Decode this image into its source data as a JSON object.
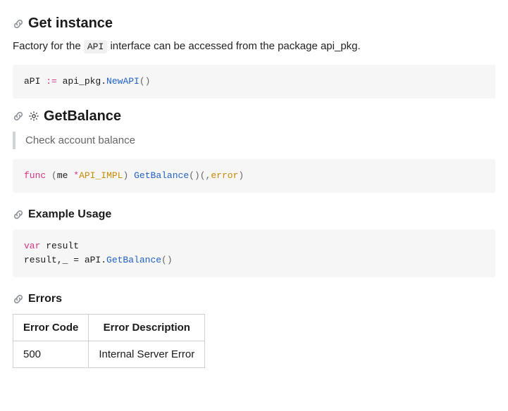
{
  "sections": {
    "get_instance": {
      "title": "Get instance",
      "para_parts": {
        "pre": "Factory for the ",
        "code": "API",
        "post": " interface can be accessed from the package api_pkg."
      },
      "code": {
        "t1": "aPI ",
        "t2": ":=",
        "t3": " api_pkg.",
        "t4": "NewAPI",
        "t5": "()"
      }
    },
    "get_balance": {
      "title": "GetBalance",
      "desc": "Check account balance",
      "code": {
        "t1": "func",
        "t2": " ",
        "t3": "(",
        "t4": "me ",
        "t5": "*",
        "t6": "API_IMPL",
        "t7": ")",
        "t8": " ",
        "t9": "GetBalance",
        "t10": "()(,",
        "t11": "error",
        "t12": ")"
      }
    },
    "example": {
      "title": "Example Usage",
      "code": {
        "line1": {
          "t1": "var",
          "t2": " result "
        },
        "line2": {
          "t1": "result,_ = aPI.",
          "t2": "GetBalance",
          "t3": "()"
        }
      }
    },
    "errors": {
      "title": "Errors",
      "table": {
        "headers": {
          "code": "Error Code",
          "desc": "Error Description"
        },
        "rows": [
          {
            "code": "500",
            "desc": "Internal Server Error"
          }
        ]
      }
    }
  }
}
